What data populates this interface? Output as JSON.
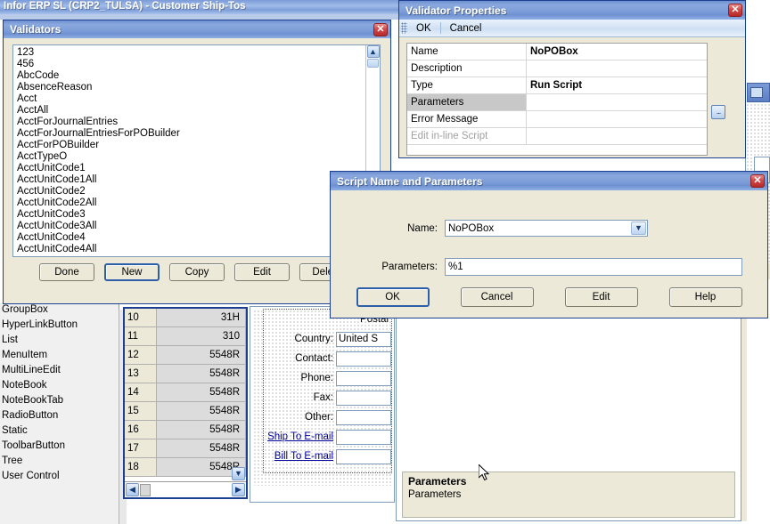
{
  "app": {
    "title": "Infor ERP SL (CRP2_TULSA) - Customer Ship-Tos"
  },
  "palette": {
    "items": [
      {
        "label": "GroupBox"
      },
      {
        "label": "HyperLinkButton"
      },
      {
        "label": "List"
      },
      {
        "label": "MenuItem"
      },
      {
        "label": "MultiLineEdit"
      },
      {
        "label": "NoteBook"
      },
      {
        "label": "NoteBookTab"
      },
      {
        "label": "RadioButton"
      },
      {
        "label": "Static"
      },
      {
        "label": "ToolbarButton"
      },
      {
        "label": "Tree"
      },
      {
        "label": "User Control"
      }
    ]
  },
  "grid": {
    "rows": [
      {
        "num": "10",
        "value": "31H"
      },
      {
        "num": "11",
        "value": "310"
      },
      {
        "num": "12",
        "value": "5548R"
      },
      {
        "num": "13",
        "value": "5548R"
      },
      {
        "num": "14",
        "value": "5548R"
      },
      {
        "num": "15",
        "value": "5548R"
      },
      {
        "num": "16",
        "value": "5548R"
      },
      {
        "num": "17",
        "value": "5548R"
      },
      {
        "num": "18",
        "value": "5548R"
      }
    ],
    "scroll_down_icon": "chevron-down-icon",
    "scroll_left_icon": "chevron-left-icon",
    "scroll_right_icon": "chevron-right-icon"
  },
  "form": {
    "rows": [
      {
        "label": "Postal",
        "value": "",
        "link": false,
        "has_input": false
      },
      {
        "label": "Country:",
        "value": "United S",
        "link": false,
        "has_input": true
      },
      {
        "label": "Contact:",
        "value": "",
        "link": false,
        "has_input": true
      },
      {
        "label": "Phone:",
        "value": "",
        "link": false,
        "has_input": true
      },
      {
        "label": "Fax:",
        "value": "",
        "link": false,
        "has_input": true
      },
      {
        "label": "Other:",
        "value": "",
        "link": false,
        "has_input": true
      },
      {
        "label": "Ship To E-mail",
        "value": "",
        "link": true,
        "has_input": true
      },
      {
        "label": "Bill To E-mail",
        "value": "",
        "link": true,
        "has_input": true
      }
    ]
  },
  "validators": {
    "title": "Validators",
    "close_icon": "close-icon",
    "scroll_up_icon": "chevron-up-icon",
    "items": [
      "123",
      "456",
      "AbcCode",
      "AbsenceReason",
      "Acct",
      "AcctAll",
      "AcctForJournalEntries",
      "AcctForJournalEntriesForPOBuilder",
      "AcctForPOBuilder",
      "AcctTypeO",
      "AcctUnitCode1",
      "AcctUnitCode1All",
      "AcctUnitCode2",
      "AcctUnitCode2All",
      "AcctUnitCode3",
      "AcctUnitCode3All",
      "AcctUnitCode4",
      "AcctUnitCode4All"
    ],
    "buttons": [
      {
        "label": "Done",
        "focused": false
      },
      {
        "label": "New",
        "focused": true
      },
      {
        "label": "Copy",
        "focused": false
      },
      {
        "label": "Edit",
        "focused": false
      },
      {
        "label": "Delete",
        "focused": false
      }
    ]
  },
  "validator_properties": {
    "title": "Validator Properties",
    "close_icon": "close-icon",
    "toolbar": {
      "ok_label": "OK",
      "cancel_label": "Cancel"
    },
    "ellipsis_label": "...",
    "rows": [
      {
        "name": "Name",
        "value": "NoPOBox",
        "selected": false,
        "disabled": false
      },
      {
        "name": "Description",
        "value": "",
        "selected": false,
        "disabled": false
      },
      {
        "name": "Type",
        "value": "Run Script",
        "selected": false,
        "disabled": false
      },
      {
        "name": "Parameters",
        "value": "",
        "selected": true,
        "disabled": false
      },
      {
        "name": "Error Message",
        "value": "",
        "selected": false,
        "disabled": false
      },
      {
        "name": "Edit in-line Script",
        "value": "",
        "selected": false,
        "disabled": true
      }
    ]
  },
  "script_dialog": {
    "title": "Script Name and Parameters",
    "close_icon": "close-icon",
    "name_label": "Name:",
    "name_value": "NoPOBox",
    "name_dropdown_icon": "chevron-down-icon",
    "parameters_label": "Parameters:",
    "parameters_value": "%1",
    "buttons": [
      {
        "label": "OK",
        "focused": true
      },
      {
        "label": "Cancel",
        "focused": false
      },
      {
        "label": "Edit",
        "focused": false
      },
      {
        "label": "Help",
        "focused": false
      }
    ]
  },
  "parameters_pane": {
    "title": "Parameters",
    "description": "Parameters"
  },
  "colors": {
    "titlebar_blue": "#7e9ed9",
    "dialog_face": "#ece9d8",
    "close_red": "#c03a3a",
    "link_blue": "#00019a",
    "border_navy": "#1d3f91"
  }
}
